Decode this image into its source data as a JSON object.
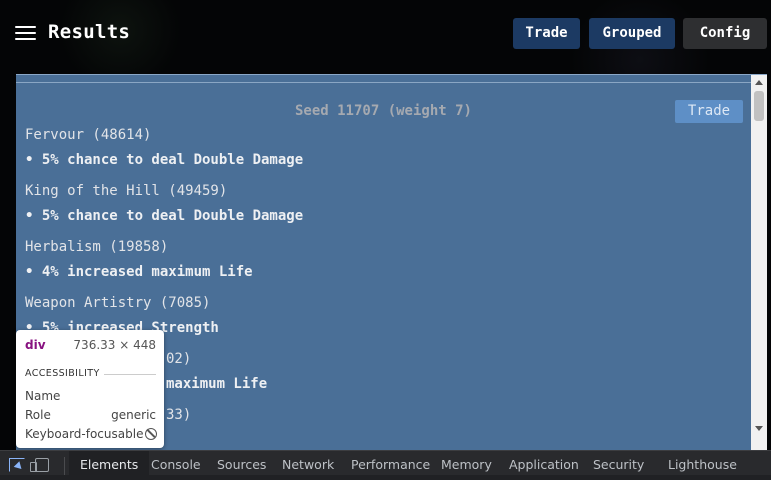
{
  "header": {
    "title": "Results",
    "buttons": {
      "trade": "Trade",
      "grouped": "Grouped",
      "config": "Config"
    }
  },
  "seed": {
    "title": "Seed 11707 (weight 7)",
    "trade_label": "Trade",
    "entries": [
      {
        "name": "Fervour (48614)",
        "mod": "• 5% chance to deal Double Damage"
      },
      {
        "name": "King of the Hill (49459)",
        "mod": "• 5% chance to deal Double Damage"
      },
      {
        "name": "Herbalism (19858)",
        "mod": "• 4% increased maximum Life"
      },
      {
        "name": "Weapon Artistry (7085)",
        "mod": "• 5% increased Strength"
      },
      {
        "name": "02)",
        "mod": "maximum Life"
      },
      {
        "name": "33)",
        "mod": ""
      }
    ]
  },
  "inspector": {
    "tag": "div",
    "dims": "736.33 × 448",
    "section": "ACCESSIBILITY",
    "rows": [
      {
        "label": "Name",
        "value": ""
      },
      {
        "label": "Role",
        "value": "generic"
      },
      {
        "label": "Keyboard-focusable",
        "value": ""
      }
    ]
  },
  "devtools": {
    "tabs": [
      "Elements",
      "Console",
      "Sources",
      "Network",
      "Performance",
      "Memory",
      "Application",
      "Security",
      "Lighthouse"
    ],
    "active_tab": "Elements",
    "icons": [
      "inspect-element-icon",
      "device-toolbar-icon"
    ]
  }
}
